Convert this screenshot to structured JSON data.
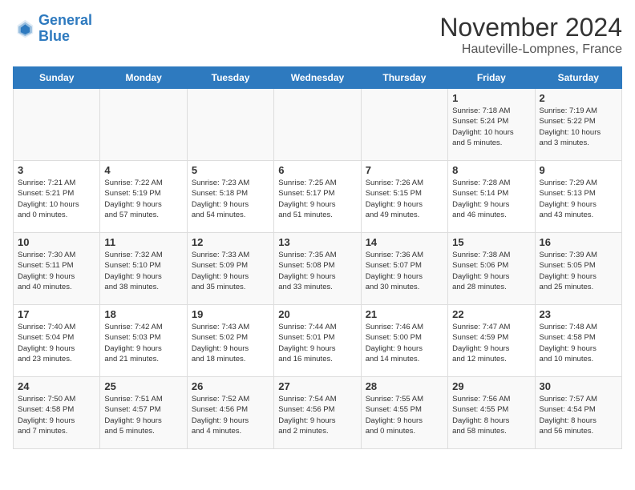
{
  "logo": {
    "line1": "General",
    "line2": "Blue"
  },
  "title": "November 2024",
  "subtitle": "Hauteville-Lompnes, France",
  "weekdays": [
    "Sunday",
    "Monday",
    "Tuesday",
    "Wednesday",
    "Thursday",
    "Friday",
    "Saturday"
  ],
  "weeks": [
    [
      {
        "day": "",
        "info": ""
      },
      {
        "day": "",
        "info": ""
      },
      {
        "day": "",
        "info": ""
      },
      {
        "day": "",
        "info": ""
      },
      {
        "day": "",
        "info": ""
      },
      {
        "day": "1",
        "info": "Sunrise: 7:18 AM\nSunset: 5:24 PM\nDaylight: 10 hours\nand 5 minutes."
      },
      {
        "day": "2",
        "info": "Sunrise: 7:19 AM\nSunset: 5:22 PM\nDaylight: 10 hours\nand 3 minutes."
      }
    ],
    [
      {
        "day": "3",
        "info": "Sunrise: 7:21 AM\nSunset: 5:21 PM\nDaylight: 10 hours\nand 0 minutes."
      },
      {
        "day": "4",
        "info": "Sunrise: 7:22 AM\nSunset: 5:19 PM\nDaylight: 9 hours\nand 57 minutes."
      },
      {
        "day": "5",
        "info": "Sunrise: 7:23 AM\nSunset: 5:18 PM\nDaylight: 9 hours\nand 54 minutes."
      },
      {
        "day": "6",
        "info": "Sunrise: 7:25 AM\nSunset: 5:17 PM\nDaylight: 9 hours\nand 51 minutes."
      },
      {
        "day": "7",
        "info": "Sunrise: 7:26 AM\nSunset: 5:15 PM\nDaylight: 9 hours\nand 49 minutes."
      },
      {
        "day": "8",
        "info": "Sunrise: 7:28 AM\nSunset: 5:14 PM\nDaylight: 9 hours\nand 46 minutes."
      },
      {
        "day": "9",
        "info": "Sunrise: 7:29 AM\nSunset: 5:13 PM\nDaylight: 9 hours\nand 43 minutes."
      }
    ],
    [
      {
        "day": "10",
        "info": "Sunrise: 7:30 AM\nSunset: 5:11 PM\nDaylight: 9 hours\nand 40 minutes."
      },
      {
        "day": "11",
        "info": "Sunrise: 7:32 AM\nSunset: 5:10 PM\nDaylight: 9 hours\nand 38 minutes."
      },
      {
        "day": "12",
        "info": "Sunrise: 7:33 AM\nSunset: 5:09 PM\nDaylight: 9 hours\nand 35 minutes."
      },
      {
        "day": "13",
        "info": "Sunrise: 7:35 AM\nSunset: 5:08 PM\nDaylight: 9 hours\nand 33 minutes."
      },
      {
        "day": "14",
        "info": "Sunrise: 7:36 AM\nSunset: 5:07 PM\nDaylight: 9 hours\nand 30 minutes."
      },
      {
        "day": "15",
        "info": "Sunrise: 7:38 AM\nSunset: 5:06 PM\nDaylight: 9 hours\nand 28 minutes."
      },
      {
        "day": "16",
        "info": "Sunrise: 7:39 AM\nSunset: 5:05 PM\nDaylight: 9 hours\nand 25 minutes."
      }
    ],
    [
      {
        "day": "17",
        "info": "Sunrise: 7:40 AM\nSunset: 5:04 PM\nDaylight: 9 hours\nand 23 minutes."
      },
      {
        "day": "18",
        "info": "Sunrise: 7:42 AM\nSunset: 5:03 PM\nDaylight: 9 hours\nand 21 minutes."
      },
      {
        "day": "19",
        "info": "Sunrise: 7:43 AM\nSunset: 5:02 PM\nDaylight: 9 hours\nand 18 minutes."
      },
      {
        "day": "20",
        "info": "Sunrise: 7:44 AM\nSunset: 5:01 PM\nDaylight: 9 hours\nand 16 minutes."
      },
      {
        "day": "21",
        "info": "Sunrise: 7:46 AM\nSunset: 5:00 PM\nDaylight: 9 hours\nand 14 minutes."
      },
      {
        "day": "22",
        "info": "Sunrise: 7:47 AM\nSunset: 4:59 PM\nDaylight: 9 hours\nand 12 minutes."
      },
      {
        "day": "23",
        "info": "Sunrise: 7:48 AM\nSunset: 4:58 PM\nDaylight: 9 hours\nand 10 minutes."
      }
    ],
    [
      {
        "day": "24",
        "info": "Sunrise: 7:50 AM\nSunset: 4:58 PM\nDaylight: 9 hours\nand 7 minutes."
      },
      {
        "day": "25",
        "info": "Sunrise: 7:51 AM\nSunset: 4:57 PM\nDaylight: 9 hours\nand 5 minutes."
      },
      {
        "day": "26",
        "info": "Sunrise: 7:52 AM\nSunset: 4:56 PM\nDaylight: 9 hours\nand 4 minutes."
      },
      {
        "day": "27",
        "info": "Sunrise: 7:54 AM\nSunset: 4:56 PM\nDaylight: 9 hours\nand 2 minutes."
      },
      {
        "day": "28",
        "info": "Sunrise: 7:55 AM\nSunset: 4:55 PM\nDaylight: 9 hours\nand 0 minutes."
      },
      {
        "day": "29",
        "info": "Sunrise: 7:56 AM\nSunset: 4:55 PM\nDaylight: 8 hours\nand 58 minutes."
      },
      {
        "day": "30",
        "info": "Sunrise: 7:57 AM\nSunset: 4:54 PM\nDaylight: 8 hours\nand 56 minutes."
      }
    ]
  ]
}
